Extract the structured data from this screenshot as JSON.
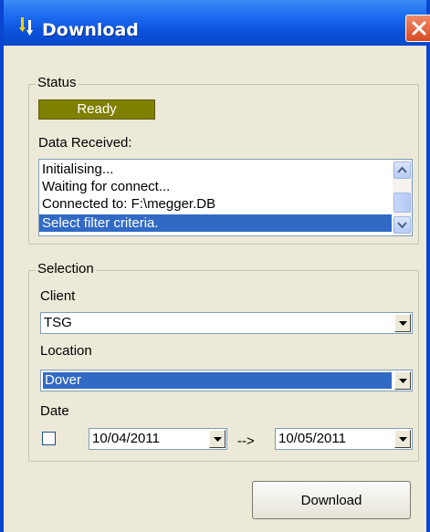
{
  "window": {
    "title": "Download"
  },
  "status_group": {
    "legend": "Status",
    "indicator": "Ready",
    "data_received_label": "Data Received:",
    "log_items": [
      "Initialising...",
      "Waiting for connect...",
      "Connected to: F:\\megger.DB",
      "Select filter criteria."
    ],
    "selected_index": 3
  },
  "selection_group": {
    "legend": "Selection",
    "client_label": "Client",
    "client_value": "TSG",
    "location_label": "Location",
    "location_value": "Dover",
    "date_label": "Date",
    "date_checked": false,
    "date_from": "10/04/2011",
    "date_arrow": "-->",
    "date_to": "10/05/2011"
  },
  "buttons": {
    "download_label": "Download"
  },
  "colors": {
    "status_ready": "#808000",
    "selection_highlight": "#316ac5",
    "titlebar": "#0b52dc",
    "dialog_background": "#ece9d8"
  }
}
